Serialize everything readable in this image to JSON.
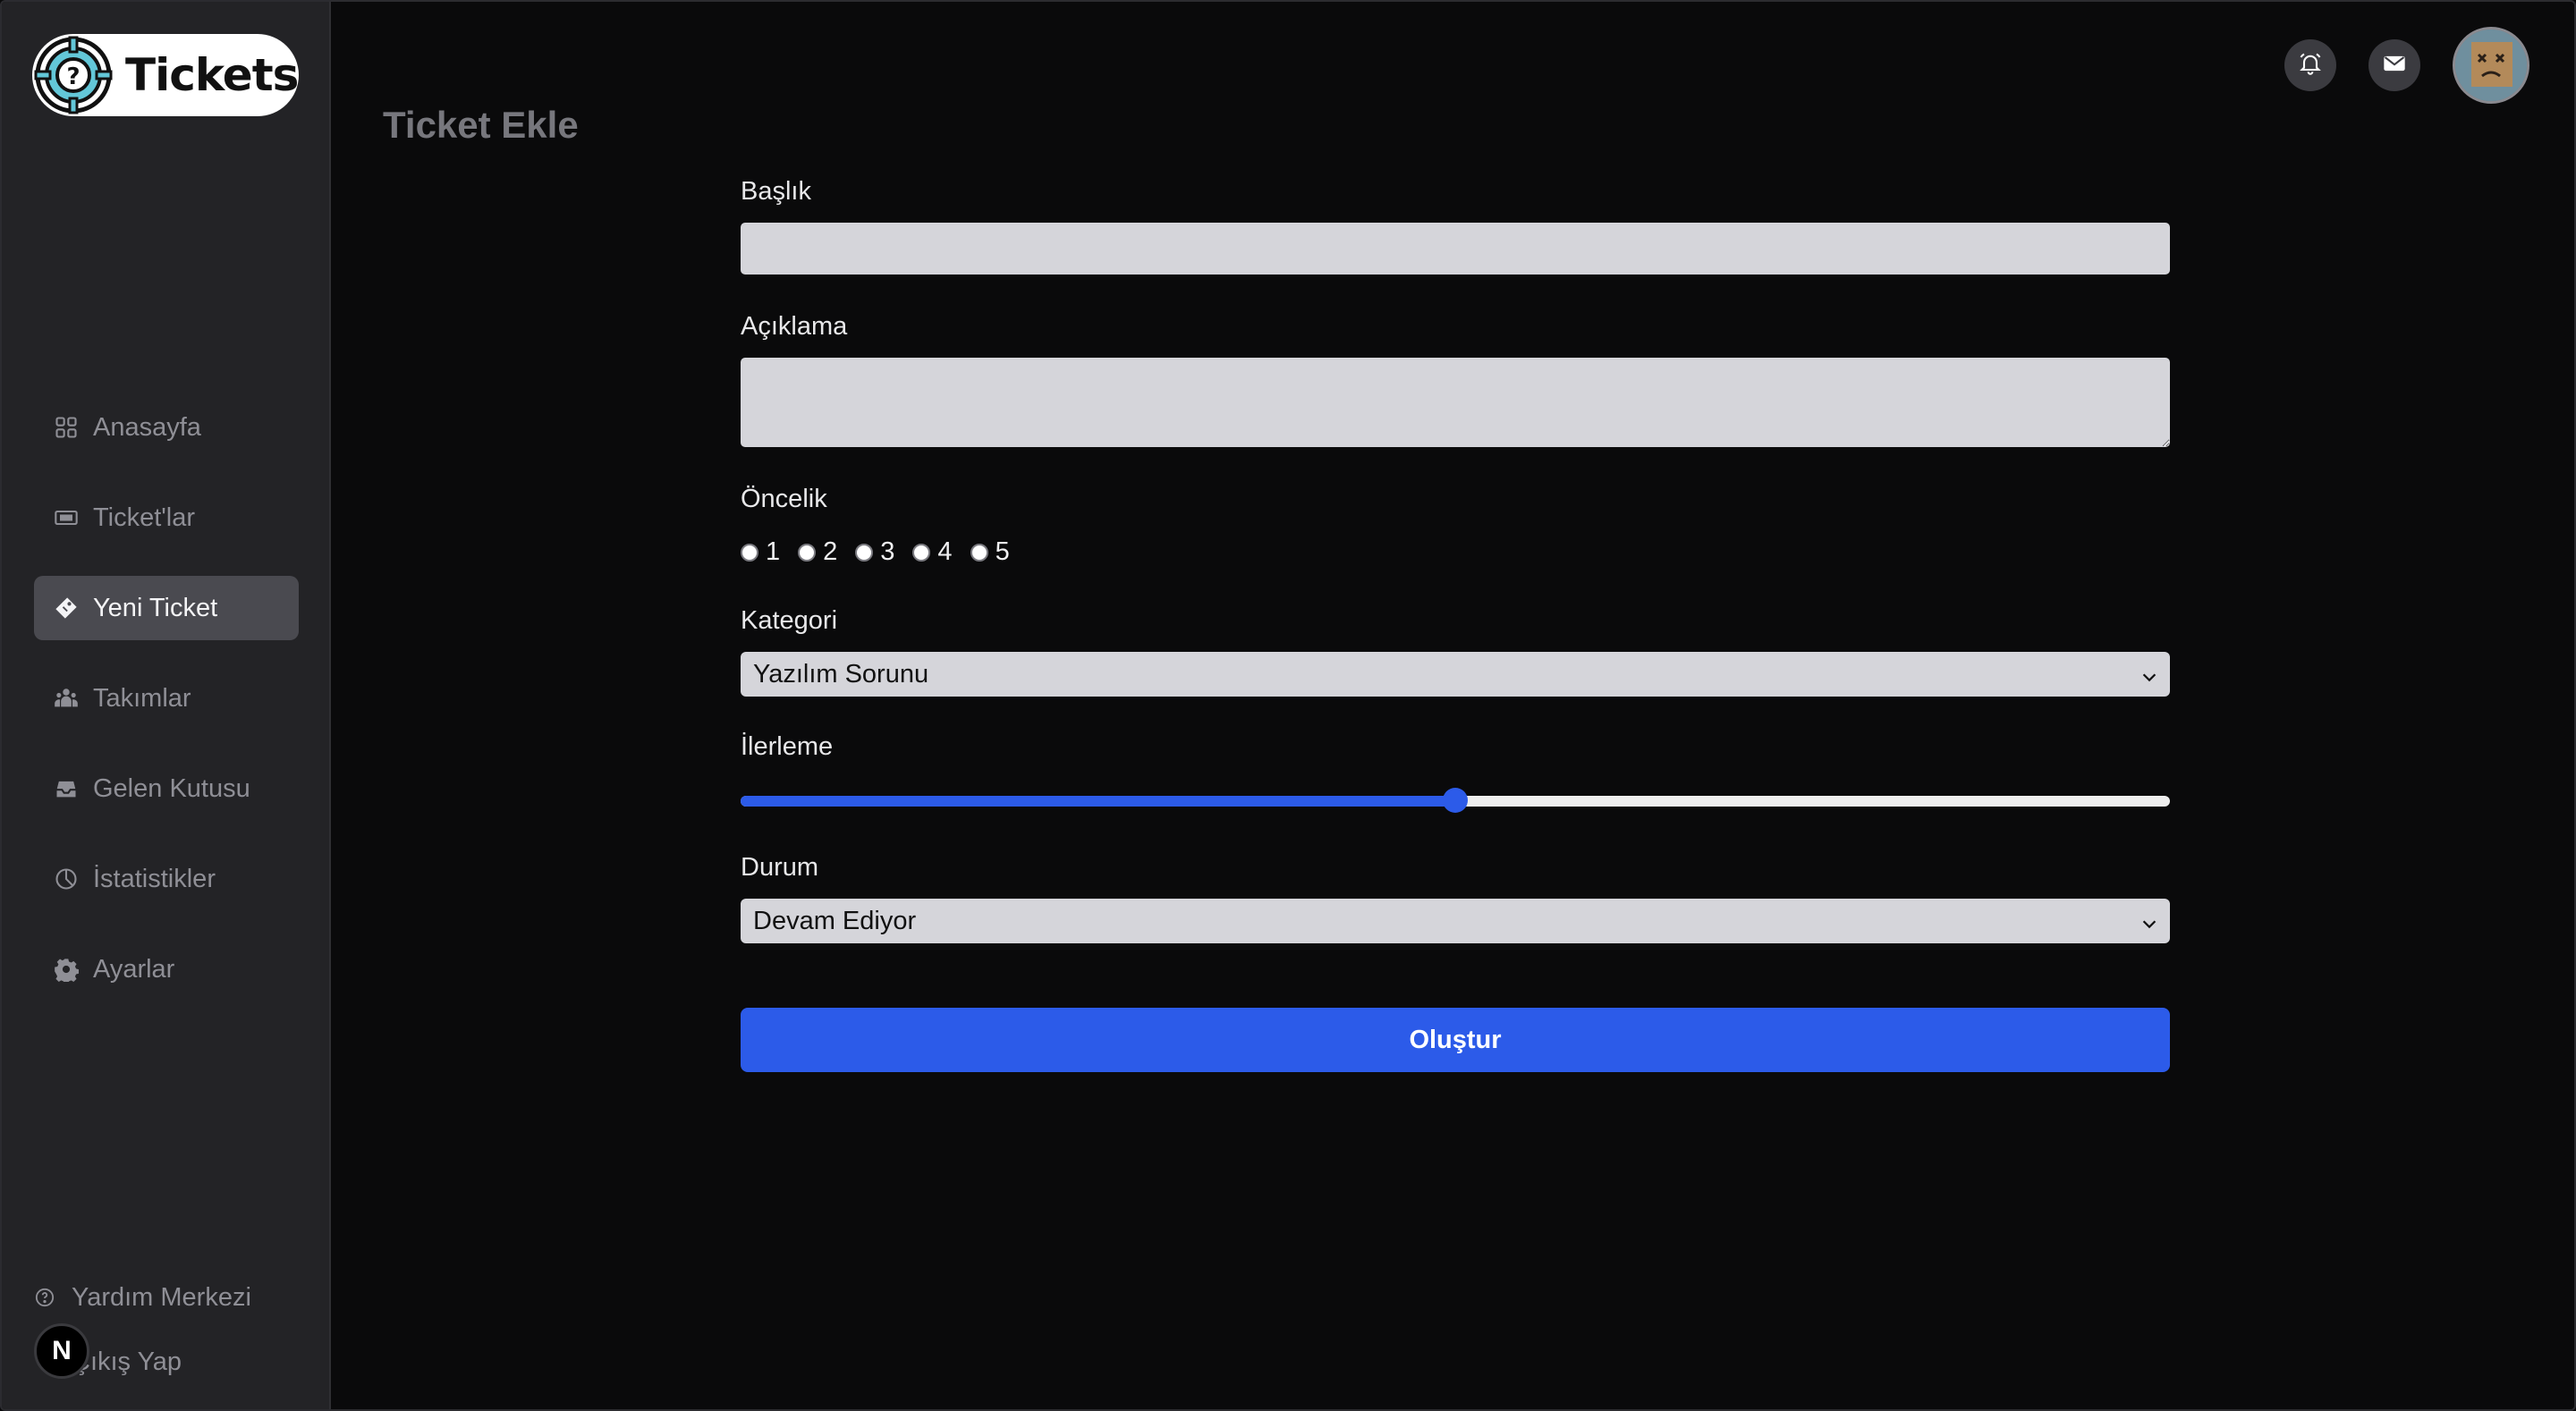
{
  "brand": {
    "name": "Tickets"
  },
  "page": {
    "title": "Ticket Ekle"
  },
  "sidebar": {
    "items": [
      {
        "label": "Anasayfa",
        "icon": "grid-icon",
        "active": false
      },
      {
        "label": "Ticket'lar",
        "icon": "ticket-icon",
        "active": false
      },
      {
        "label": "Yeni Ticket",
        "icon": "tag-icon",
        "active": true
      },
      {
        "label": "Takımlar",
        "icon": "team-icon",
        "active": false
      },
      {
        "label": "Gelen Kutusu",
        "icon": "inbox-icon",
        "active": false
      },
      {
        "label": "İstatistikler",
        "icon": "pie-chart-icon",
        "active": false
      },
      {
        "label": "Ayarlar",
        "icon": "gear-icon",
        "active": false
      }
    ],
    "help_label": "Yardım Merkezi",
    "logout_label": "Çıkış Yap",
    "badge_letter": "N"
  },
  "form": {
    "title_label": "Başlık",
    "title_value": "",
    "description_label": "Açıklama",
    "description_value": "",
    "priority_label": "Öncelik",
    "priority_options": [
      "1",
      "2",
      "3",
      "4",
      "5"
    ],
    "category_label": "Kategori",
    "category_value": "Yazılım Sorunu",
    "progress_label": "İlerleme",
    "progress_value": 0.5,
    "status_label": "Durum",
    "status_value": "Devam Ediyor",
    "submit_label": "Oluştur"
  },
  "colors": {
    "accent": "#2c5be9",
    "background": "#0a0a0b",
    "sidebar": "#232326",
    "input": "#d5d5da"
  }
}
